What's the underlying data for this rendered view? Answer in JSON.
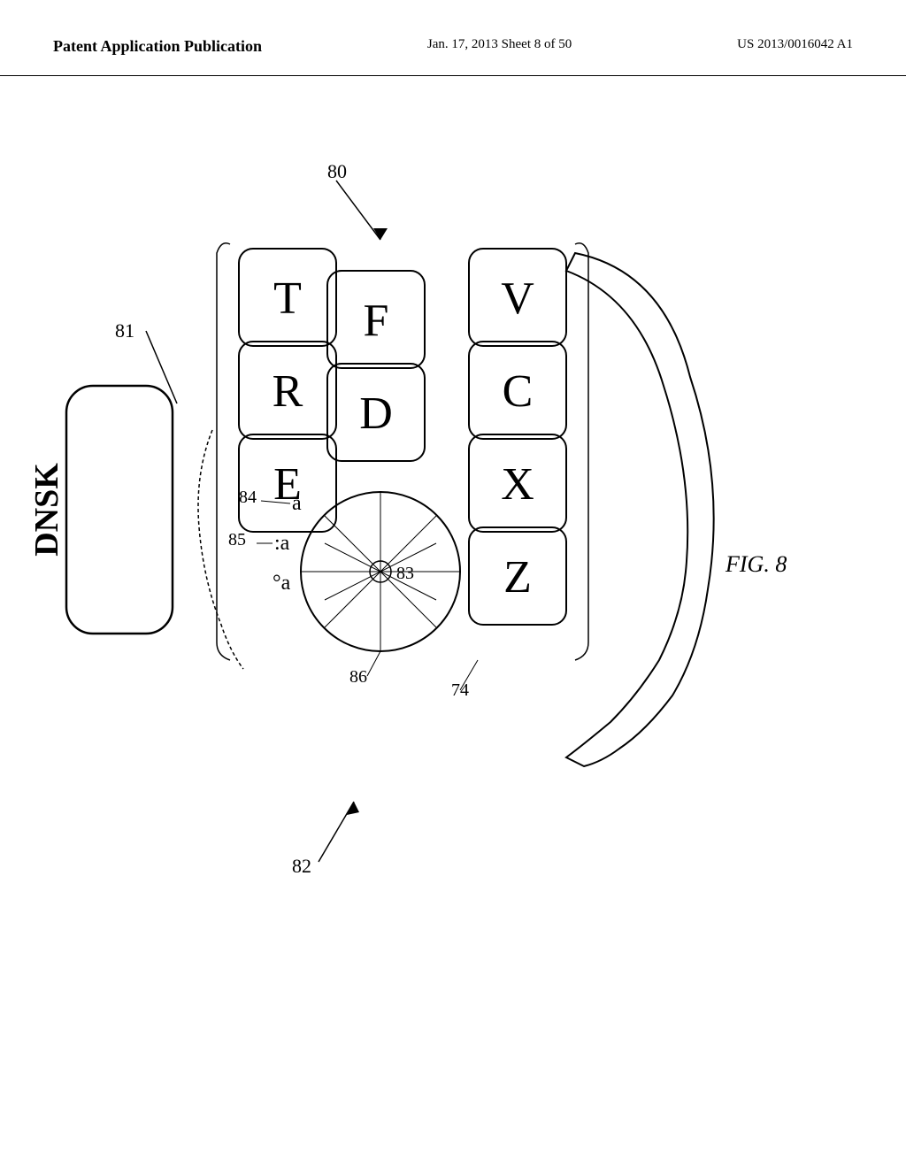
{
  "header": {
    "left_label": "Patent Application Publication",
    "center_label": "Jan. 17, 2013  Sheet 8 of 50",
    "right_label": "US 2013/0016042 A1"
  },
  "figure": {
    "label": "FIG. 8",
    "elements": {
      "label_80": "80",
      "label_81": "81",
      "label_82": "82",
      "label_83": "83",
      "label_84": "84",
      "label_85": "85",
      "label_86": "86",
      "label_74": "74",
      "key_T": "T",
      "key_R": "R",
      "key_E": "E",
      "key_F": "F",
      "key_D": "D",
      "key_V": "V",
      "key_C": "C",
      "key_X": "X",
      "key_Z": "Z",
      "key_DNSK": "DNSK",
      "key_a_small": "a",
      "key_a_colon": ":a",
      "key_a_dot": "°a"
    }
  }
}
